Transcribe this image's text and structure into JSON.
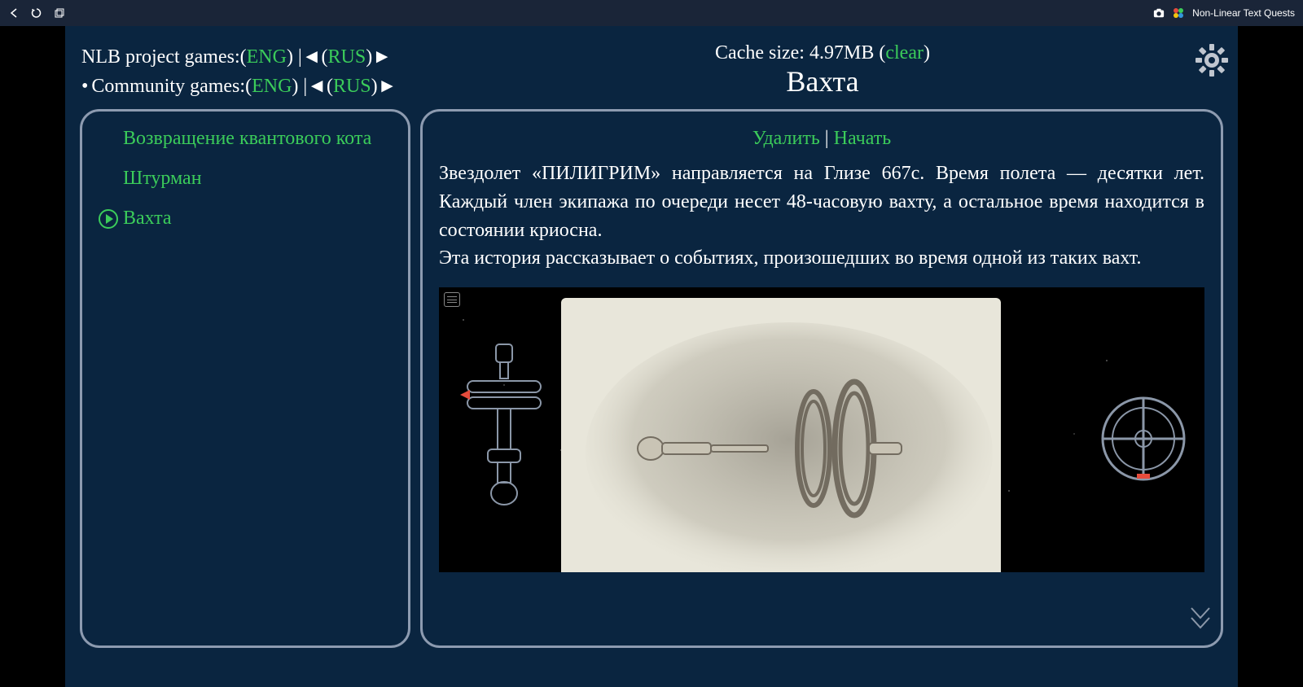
{
  "titlebar": {
    "app_name": "Non-Linear Text Quests"
  },
  "header": {
    "nlb_label": "NLB project games: ",
    "community_label": "Community games: ",
    "eng": "ENG",
    "rus": "RUS",
    "cache_prefix": "Cache size: ",
    "cache_size": "4.97MB",
    "clear": "clear",
    "title": "Вахта"
  },
  "game_list": [
    {
      "name": "Возвращение квантового кота",
      "active": false
    },
    {
      "name": "Штурман",
      "active": false
    },
    {
      "name": "Вахта",
      "active": true
    }
  ],
  "actions": {
    "delete": "Удалить",
    "start": "Начать"
  },
  "description": {
    "p1": "Звездолет «ПИЛИГРИМ» направляется на Глизе 667с. Время полета — десятки лет. Каждый член экипажа по очереди несет 48-часовую вахту, а остальное время находится в состоянии криосна.",
    "p2": "Эта история рассказывает о событиях, произошедших во время одной из таких вахт."
  }
}
